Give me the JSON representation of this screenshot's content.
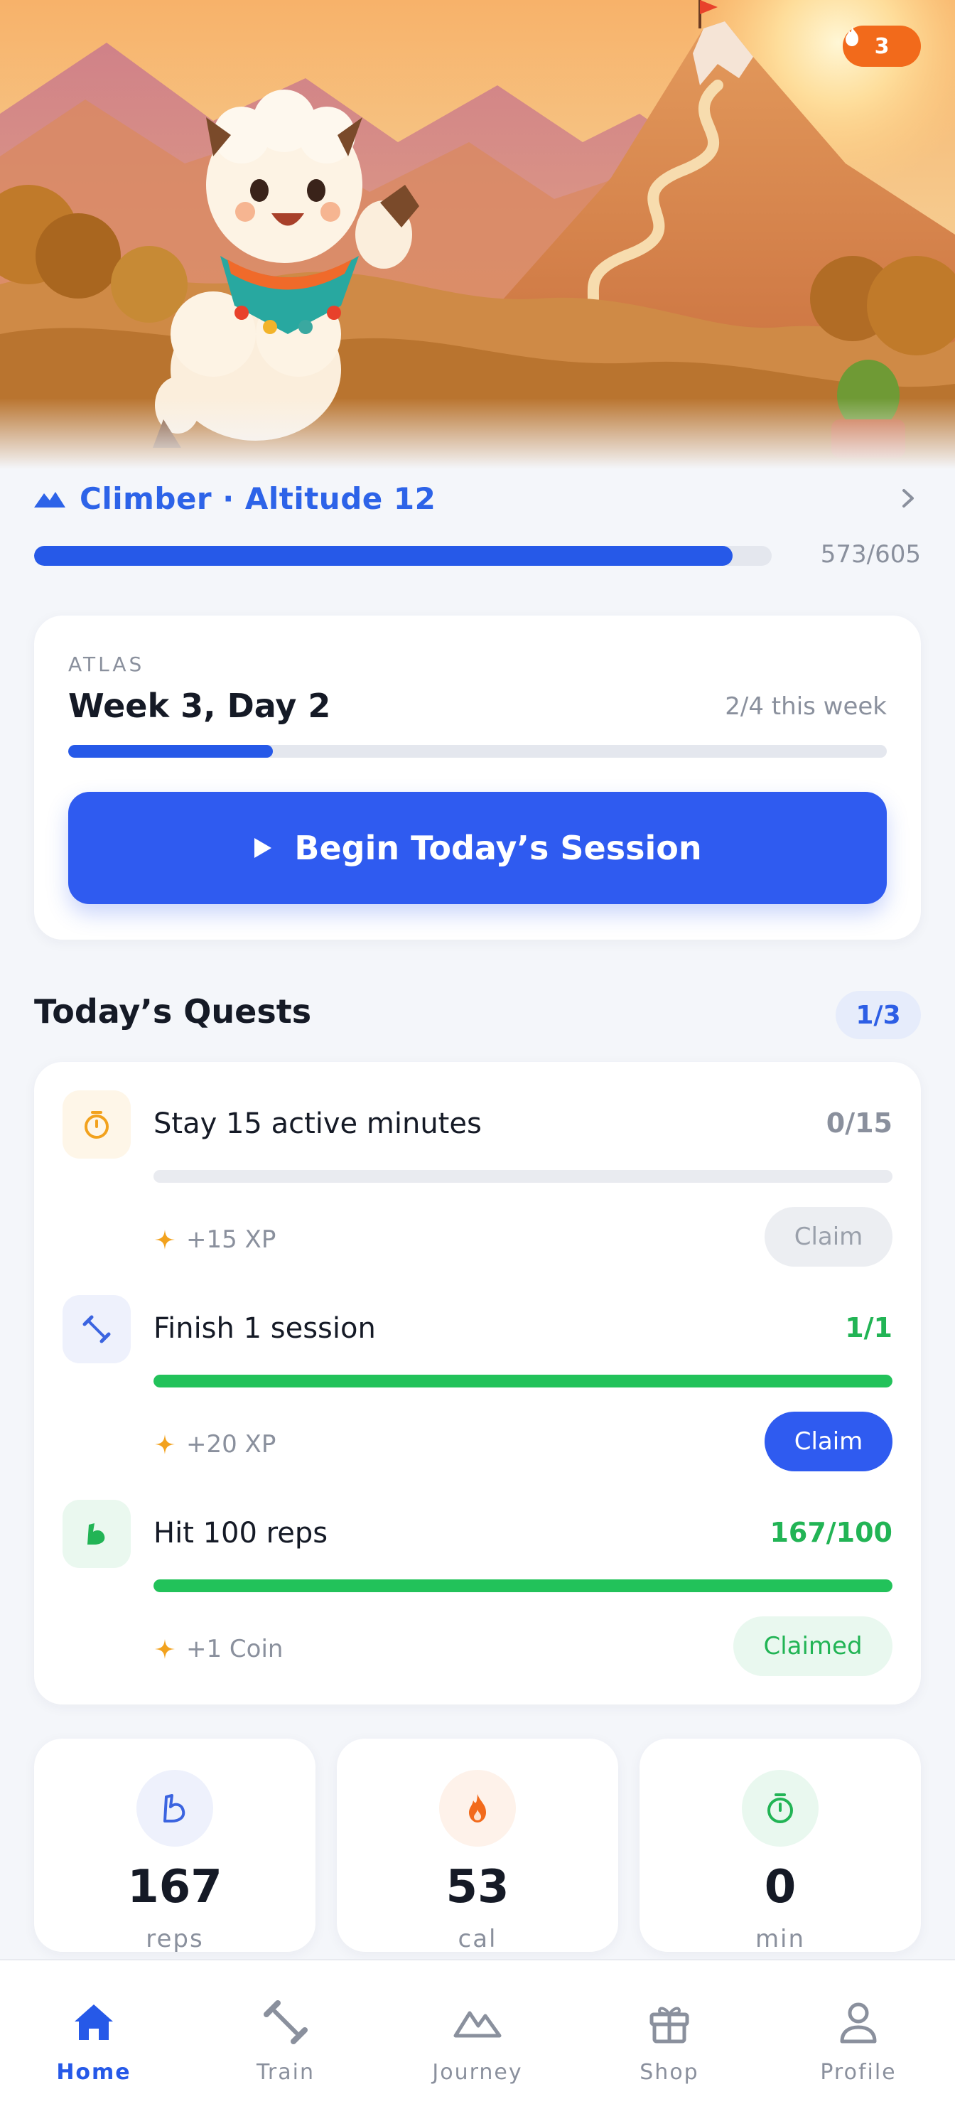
{
  "header": {
    "streak_count": "3",
    "level_title": "Climber · Altitude 12",
    "xp_text": "573/605",
    "xp_progress": 0.947
  },
  "program": {
    "label": "ATLAS",
    "week_day": "Week 3, Day 2",
    "week_count": "2/4 this week",
    "progress": 0.25,
    "begin_label": "Begin Today’s Session"
  },
  "quests": {
    "title": "Today’s Quests",
    "badge": "1/3",
    "items": [
      {
        "name": "Stay 15 active minutes",
        "progress_text": "0/15",
        "progress": 0.0,
        "reward": "+15 XP",
        "button": "Claim",
        "state": "locked",
        "icon": "stopwatch-icon"
      },
      {
        "name": "Finish 1 session",
        "progress_text": "1/1",
        "progress": 1.0,
        "reward": "+20 XP",
        "button": "Claim",
        "state": "claimable",
        "icon": "dumbbell-icon"
      },
      {
        "name": "Hit 100 reps",
        "progress_text": "167/100",
        "progress": 1.0,
        "reward": "+1 Coin",
        "button": "Claimed",
        "state": "claimed",
        "icon": "muscle-icon"
      }
    ]
  },
  "stats": [
    {
      "value": "167",
      "unit": "reps",
      "icon": "muscle-icon",
      "color": "#3b64e0"
    },
    {
      "value": "53",
      "unit": "cal",
      "icon": "flame-icon",
      "color": "#f26a1b"
    },
    {
      "value": "0",
      "unit": "min",
      "icon": "stopwatch-icon",
      "color": "#22b455"
    }
  ],
  "tabs": [
    {
      "label": "Home",
      "icon": "home-icon",
      "active": true
    },
    {
      "label": "Train",
      "icon": "dumbbell-icon",
      "active": false
    },
    {
      "label": "Journey",
      "icon": "mountain-icon",
      "active": false
    },
    {
      "label": "Shop",
      "icon": "gift-icon",
      "active": false
    },
    {
      "label": "Profile",
      "icon": "person-icon",
      "active": false
    }
  ],
  "colors": {
    "accent": "#2659e8",
    "success": "#22c25a",
    "streak": "#f26a1b",
    "muted": "#8a909d"
  }
}
